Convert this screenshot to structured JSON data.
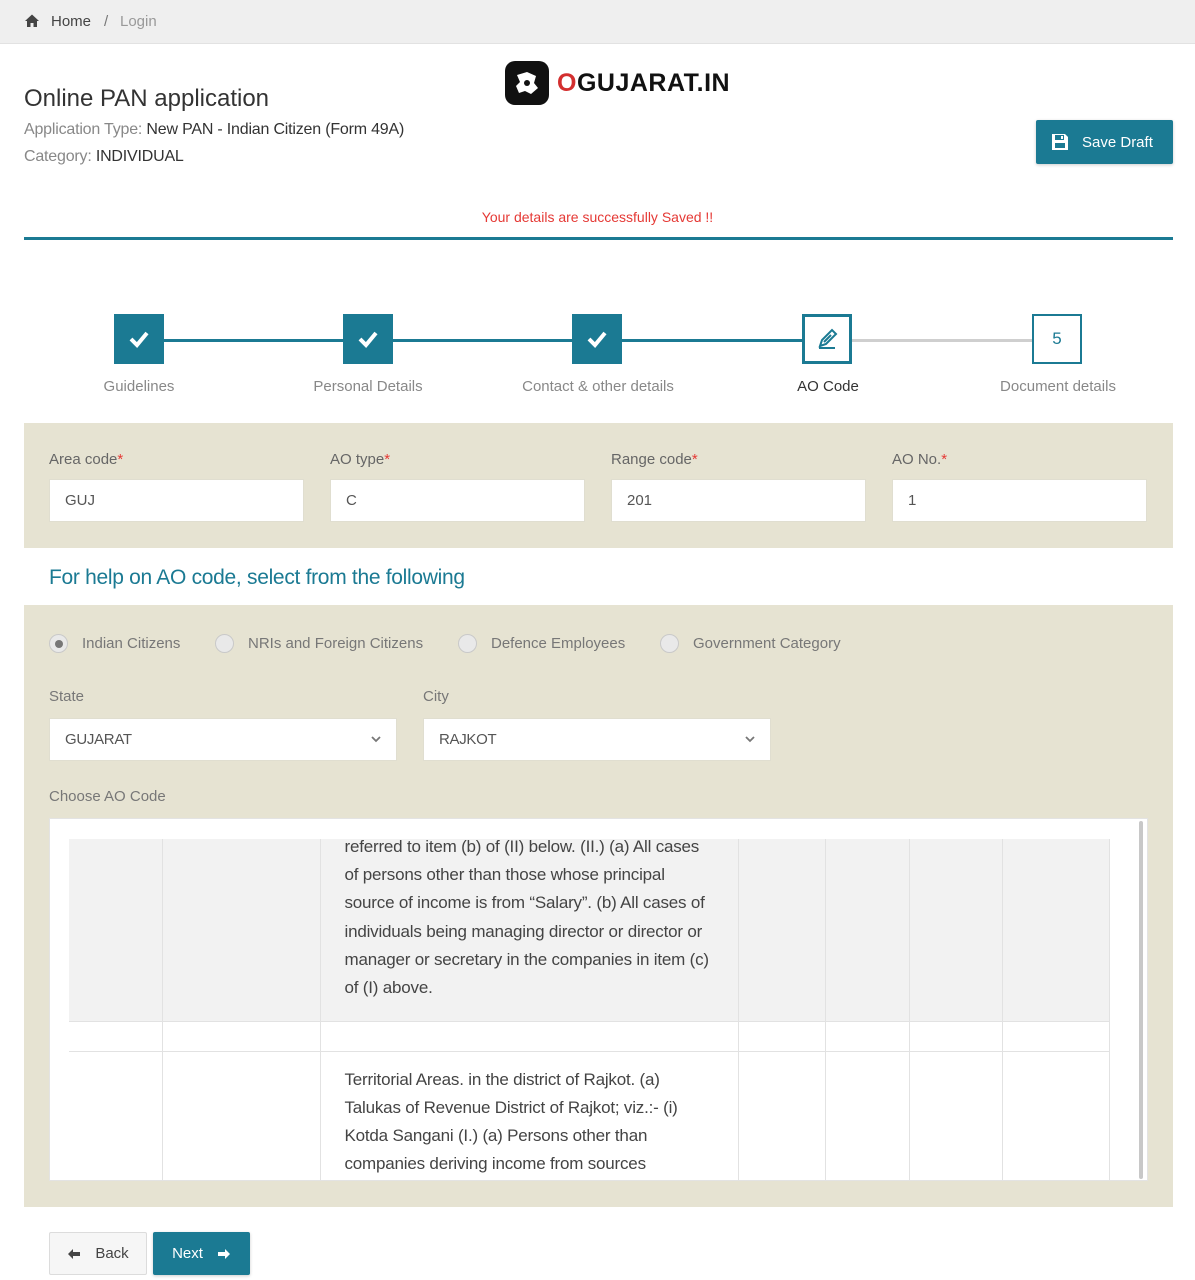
{
  "breadcrumb": {
    "home": "Home",
    "separator": "/",
    "current": "Login"
  },
  "header": {
    "title": "Online PAN application",
    "application_type_label": "Application Type: ",
    "application_type_value": "New PAN - Indian Citizen (Form 49A)",
    "category_label": "Category: ",
    "category_value": "INDIVIDUAL"
  },
  "logo": {
    "prefix": "O",
    "text": "GUJARAT.IN"
  },
  "save_draft_label": "Save Draft",
  "status_message": "Your details are successfully Saved !!",
  "steps": [
    {
      "label": "Guidelines",
      "state": "done",
      "icon": "check-icon"
    },
    {
      "label": "Personal Details",
      "state": "done",
      "icon": "check-icon"
    },
    {
      "label": "Contact & other details",
      "state": "done",
      "icon": "check-icon"
    },
    {
      "label": "AO Code",
      "state": "active",
      "icon": "pencil-icon"
    },
    {
      "label": "Document details",
      "state": "todo",
      "number": "5"
    }
  ],
  "ao_fields": {
    "area_code": {
      "label": "Area code",
      "value": "GUJ"
    },
    "ao_type": {
      "label": "AO type",
      "value": "C"
    },
    "range_code": {
      "label": "Range code",
      "value": "201"
    },
    "ao_no": {
      "label": "AO No.",
      "value": "1"
    },
    "required_mark": "*"
  },
  "help_title": "For help on AO code, select from the following",
  "radio_options": [
    {
      "label": "Indian Citizens",
      "checked": true
    },
    {
      "label": "NRIs and Foreign Citizens",
      "checked": false
    },
    {
      "label": "Defence Employees",
      "checked": false
    },
    {
      "label": "Government Category",
      "checked": false
    }
  ],
  "state_select": {
    "label": "State",
    "value": "GUJARAT"
  },
  "city_select": {
    "label": "City",
    "value": "RAJKOT"
  },
  "choose_label": "Choose AO Code",
  "ao_rows": [
    {
      "description": "referred to item (b) of (II) below. (II.) (a) All cases of persons other than those whose principal source of income is from “Salary”. (b) All cases of individuals being managing director or director or manager or secretary in the companies in item (c) of (I) above."
    },
    {
      "description": "Territorial Areas. in the district of Rajkot. (a) Talukas of Revenue District of Rajkot; viz.:- (i) Kotda Sangani (I.) (a) Persons other than companies deriving income from sources"
    }
  ],
  "buttons": {
    "back": "Back",
    "next": "Next"
  },
  "colors": {
    "primary": "#1b7a93",
    "panel": "#e6e3d2",
    "alert": "#e53935"
  }
}
